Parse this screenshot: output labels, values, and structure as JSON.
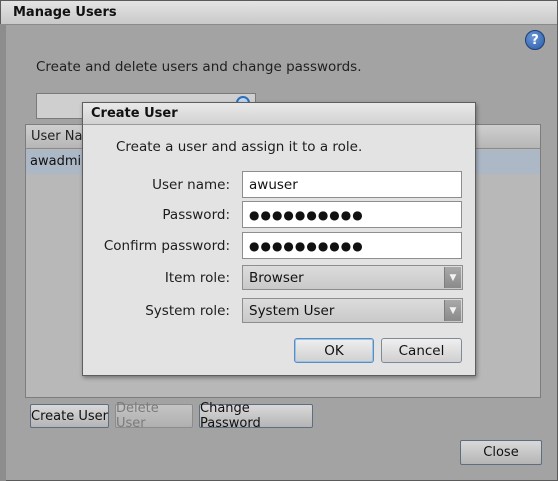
{
  "outer": {
    "title": "Manage Users",
    "description": "Create and delete users and change passwords.",
    "help_icon": "?",
    "table": {
      "columns": [
        "User Nar"
      ],
      "rows": [
        [
          "awadmin"
        ]
      ]
    },
    "buttons": {
      "create_user": "Create User",
      "delete_user": "Delete User",
      "change_password": "Change Password",
      "close": "Close"
    }
  },
  "modal": {
    "title": "Create User",
    "description": "Create a user and assign it to a role.",
    "fields": {
      "user_name": {
        "label": "User name:",
        "value": "awuser"
      },
      "password": {
        "label": "Password:",
        "value": "●●●●●●●●●●"
      },
      "confirm_password": {
        "label": "Confirm password:",
        "value": "●●●●●●●●●●"
      },
      "item_role": {
        "label": "Item role:",
        "value": "Browser"
      },
      "system_role": {
        "label": "System role:",
        "value": "System User"
      }
    },
    "buttons": {
      "ok": "OK",
      "cancel": "Cancel"
    }
  },
  "icons": {
    "help": "help-icon",
    "search": "search-icon",
    "dropdown": "chevron-down-icon"
  },
  "colors": {
    "accent": "#2c5aa3",
    "selected_row": "#adb8c6"
  }
}
